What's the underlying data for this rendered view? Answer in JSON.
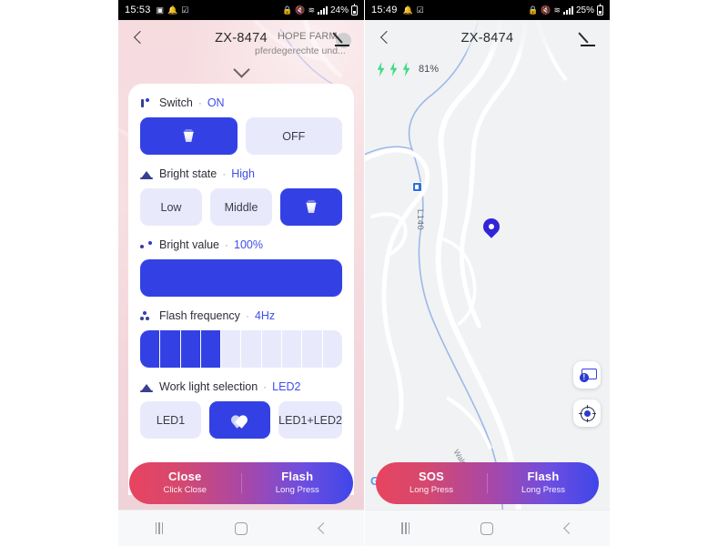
{
  "left_phone": {
    "status_bar": {
      "time": "15:53",
      "battery_percent": "24%",
      "icons": [
        "image-icon",
        "bell-icon",
        "checkbox-icon",
        "lock-icon",
        "mute-icon",
        "wifi-icon",
        "signal-icon",
        "battery-icon"
      ]
    },
    "header": {
      "back_icon": "chevron-left-icon",
      "title": "ZX-8474",
      "edit_icon": "pencil-icon"
    },
    "map_background": {
      "place_title": "HOPE FARM -",
      "place_subtitle": "pferdegerechte und...",
      "collapse_icon": "chevron-down-icon"
    },
    "sections": [
      {
        "icon": "switch-icon",
        "label": "Switch",
        "separator": "·",
        "value": "ON",
        "options": [
          {
            "label": "",
            "icon": "lamp-icon",
            "selected": true
          },
          {
            "label": "OFF",
            "icon": "",
            "selected": false
          }
        ]
      },
      {
        "icon": "brightness-icon",
        "label": "Bright state",
        "separator": "·",
        "value": "High",
        "options": [
          {
            "label": "Low",
            "icon": "",
            "selected": false
          },
          {
            "label": "Middle",
            "icon": "",
            "selected": false
          },
          {
            "label": "",
            "icon": "lamp-icon",
            "selected": true
          }
        ]
      },
      {
        "icon": "spark-icon",
        "label": "Bright value",
        "separator": "·",
        "value": "100%",
        "slider_percent": 100
      },
      {
        "icon": "dots-icon",
        "label": "Flash frequency",
        "separator": "·",
        "value": "4Hz",
        "segments_total": 10,
        "segments_filled": 4
      },
      {
        "icon": "brightness-icon",
        "label": "Work light selection",
        "separator": "·",
        "value": "LED2",
        "options": [
          {
            "label": "LED1",
            "icon": "",
            "selected": false
          },
          {
            "label": "",
            "icon": "led-icon",
            "selected": true
          },
          {
            "label": "LED1+LED2",
            "icon": "",
            "selected": false
          }
        ]
      }
    ],
    "action_bar": {
      "left": {
        "title": "Close",
        "subtitle": "Click Close"
      },
      "right": {
        "title": "Flash",
        "subtitle": "Long Press"
      }
    },
    "nav_bar": {
      "recents": "recents-icon",
      "home": "home-icon",
      "back": "back-icon"
    }
  },
  "right_phone": {
    "status_bar": {
      "time": "15:49",
      "battery_percent": "25%",
      "icons": [
        "bell-icon",
        "checkbox-icon",
        "lock-icon",
        "mute-icon",
        "wifi-icon",
        "signal-icon",
        "battery-icon"
      ]
    },
    "header": {
      "back_icon": "chevron-left-icon",
      "title": "ZX-8474",
      "edit_icon": "pencil-icon"
    },
    "battery_indicator": {
      "bolt_count": 3,
      "percent": "81%",
      "bolt_color": "#3ddc84"
    },
    "map": {
      "road_label": "L140",
      "street_label": "Waldweg Str",
      "watermark": "Google",
      "pin_icon": "location-pin-icon",
      "poi_icon": "poi-marker-icon",
      "fabs": [
        {
          "icon": "alert-card-icon"
        },
        {
          "icon": "locate-icon"
        }
      ]
    },
    "action_bar": {
      "left": {
        "title": "SOS",
        "subtitle": "Long Press"
      },
      "right": {
        "title": "Flash",
        "subtitle": "Long Press"
      }
    },
    "nav_bar": {
      "recents": "recents-icon",
      "home": "home-icon",
      "back": "back-icon"
    }
  },
  "colors": {
    "accent_blue": "#3341e4",
    "accent_light": "#e8eafc",
    "value_text": "#3f4ee6",
    "gradient_start": "#e8445f",
    "gradient_end": "#3f46e8",
    "bolt_green": "#3ddc84",
    "pin_blue": "#3024d8"
  }
}
